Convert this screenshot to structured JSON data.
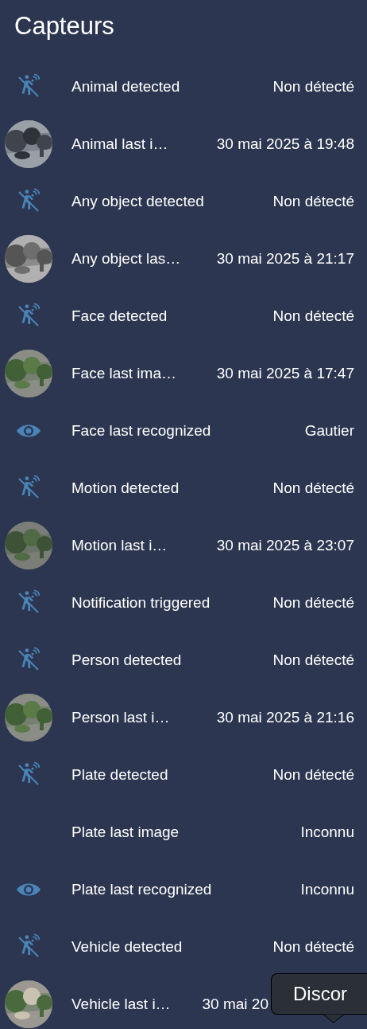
{
  "title": "Capteurs",
  "rows": [
    {
      "kind": "motion",
      "label": "Animal detected",
      "value": "Non détecté"
    },
    {
      "kind": "picture",
      "label": "Animal last i…",
      "value": "30 mai 2025 à 19:48"
    },
    {
      "kind": "motion",
      "label": "Any object detected",
      "value": "Non détecté"
    },
    {
      "kind": "picture",
      "label": "Any object las…",
      "value": "30 mai 2025 à 21:17"
    },
    {
      "kind": "motion",
      "label": "Face detected",
      "value": "Non détecté"
    },
    {
      "kind": "picture",
      "label": "Face last ima…",
      "value": "30 mai 2025 à 17:47"
    },
    {
      "kind": "eye",
      "label": "Face last recognized",
      "value": "Gautier"
    },
    {
      "kind": "motion",
      "label": "Motion detected",
      "value": "Non détecté"
    },
    {
      "kind": "picture",
      "label": "Motion last i…",
      "value": "30 mai 2025 à 23:07"
    },
    {
      "kind": "motion",
      "label": "Notification triggered",
      "value": "Non détecté"
    },
    {
      "kind": "motion",
      "label": "Person detected",
      "value": "Non détecté"
    },
    {
      "kind": "picture",
      "label": "Person last i…",
      "value": "30 mai 2025 à 21:16"
    },
    {
      "kind": "motion",
      "label": "Plate detected",
      "value": "Non détecté"
    },
    {
      "kind": "none",
      "label": "Plate last image",
      "value": "Inconnu"
    },
    {
      "kind": "eye",
      "label": "Plate last recognized",
      "value": "Inconnu"
    },
    {
      "kind": "motion",
      "label": "Vehicle detected",
      "value": "Non détecté"
    },
    {
      "kind": "picture",
      "label": "Vehicle last i…",
      "value": "30 mai 20"
    }
  ],
  "tooltip": "Discor"
}
